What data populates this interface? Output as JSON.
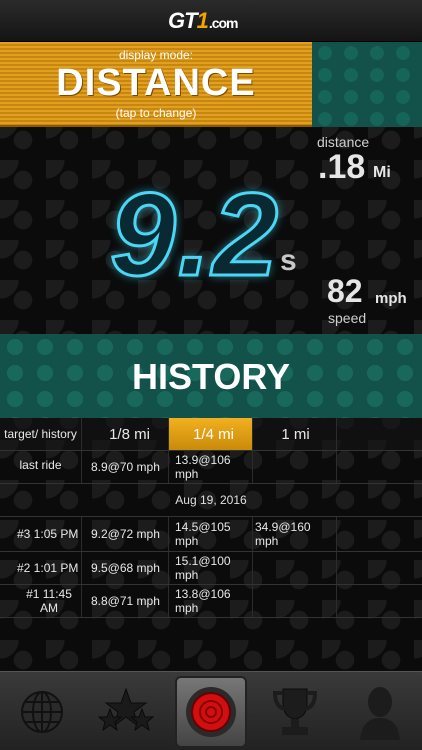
{
  "header": {
    "logo_gt": "GT",
    "logo_one": "1",
    "logo_com": ".com"
  },
  "mode": {
    "label": "display mode:",
    "value": "DISTANCE",
    "hint": "(tap to change)"
  },
  "display": {
    "time_value": "9.2",
    "time_unit": "s",
    "distance_label": "distance",
    "distance_value": ".18",
    "distance_unit": "Mi",
    "speed_value": "82",
    "speed_unit": "mph",
    "speed_label": "speed"
  },
  "history": {
    "title": "HISTORY",
    "header": {
      "col0": "target/ history",
      "col1": "1/8 mi",
      "col2": "1/4 mi",
      "col3": "1 mi",
      "active": "1/4 mi"
    },
    "last_ride": {
      "label": "last ride",
      "eighth": "8.9@70 mph",
      "quarter": "13.9@106 mph",
      "mile": ""
    },
    "date": "Aug 19, 2016",
    "rows": [
      {
        "label": "#3 1:05 PM",
        "eighth": "9.2@72 mph",
        "quarter": "14.5@105 mph",
        "mile": "34.9@160 mph"
      },
      {
        "label": "#2 1:01 PM",
        "eighth": "9.5@68 mph",
        "quarter": "15.1@100 mph",
        "mile": ""
      },
      {
        "label": "#1 11:45 AM",
        "eighth": "8.8@71 mph",
        "quarter": "13.8@106 mph",
        "mile": ""
      }
    ]
  },
  "tabbar": {
    "icons": [
      "globe-icon",
      "stars-icon",
      "stop-button-icon",
      "trophy-icon",
      "profile-icon"
    ]
  },
  "colors": {
    "accent_orange": "#e0a020",
    "teal": "#12524a",
    "digit_glow": "#49d7f5",
    "stop_red": "#d01010"
  }
}
